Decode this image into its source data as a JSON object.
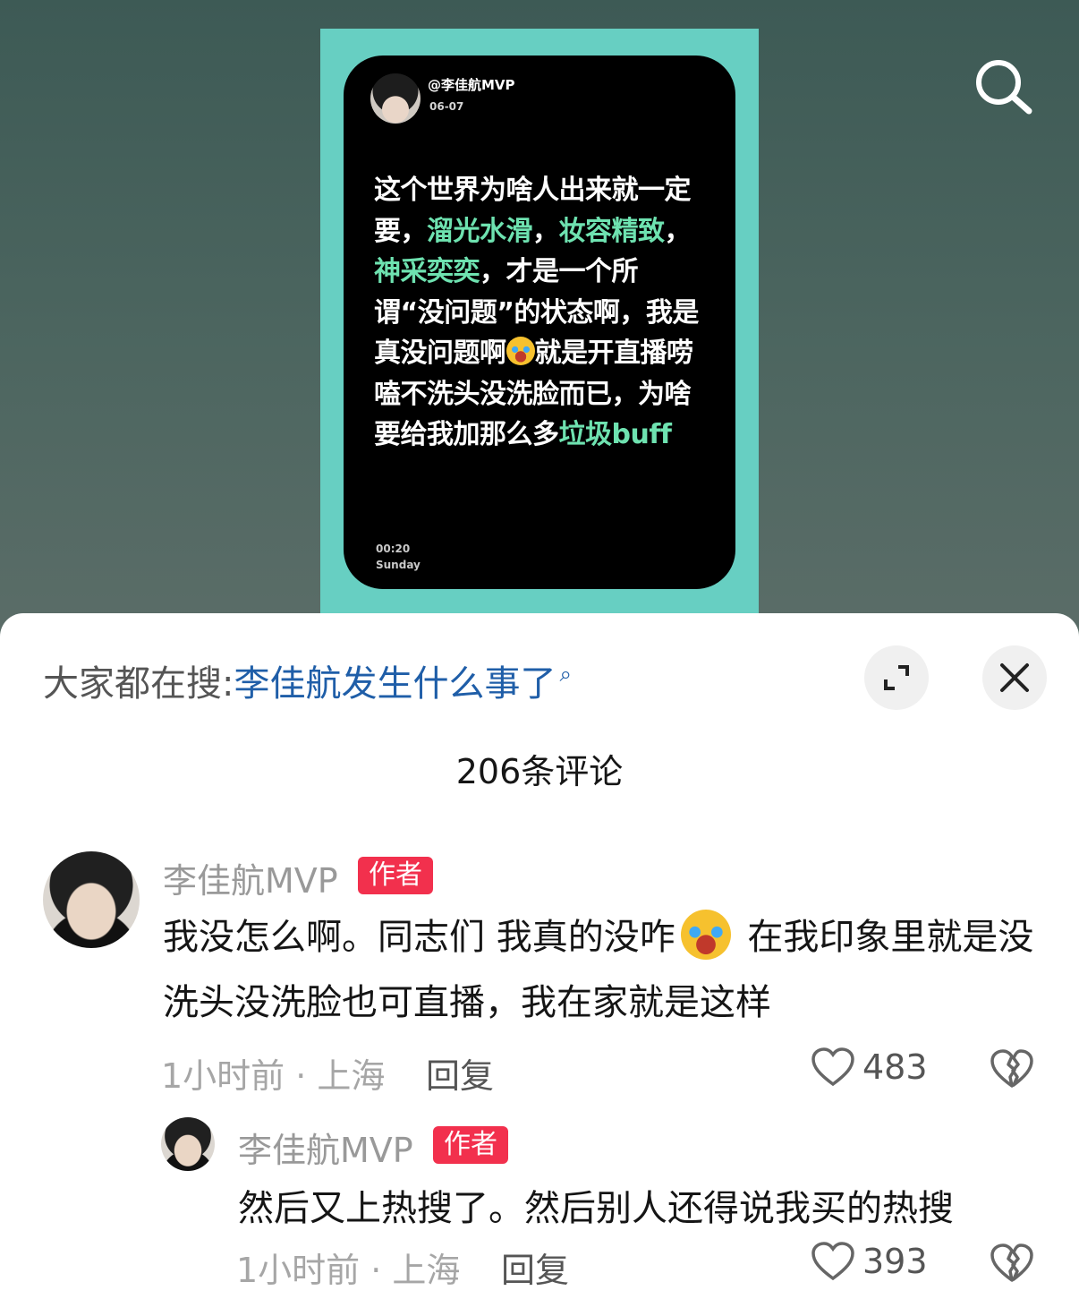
{
  "video": {
    "card": {
      "username": "@李佳航MVP",
      "date": "06-07",
      "text_segments": [
        {
          "t": "这个世界为啥人出来就一定要，",
          "hl": false
        },
        {
          "t": "溜光水滑",
          "hl": true
        },
        {
          "t": "，",
          "hl": false
        },
        {
          "t": "妆容精致",
          "hl": true
        },
        {
          "t": "，",
          "hl": false
        },
        {
          "t": "神采奕奕",
          "hl": true
        },
        {
          "t": "，才是一个所谓“没问题”的状态啊，我是真没问题啊",
          "hl": false
        },
        {
          "t": "就是开直播唠嗑不洗头没洗脸而已，为啥要给我加那么多",
          "hl": false
        },
        {
          "t": "垃圾buff",
          "hl": true
        }
      ],
      "time": "00:20",
      "day": "Sunday"
    },
    "search_icon": "search-icon",
    "colors": {
      "poster_bg": "#67cfc2",
      "highlight": "#6ee2b0"
    }
  },
  "sheet": {
    "trending_prefix": "大家都在搜:",
    "trending_term": "李佳航发生什么事了",
    "comment_count": "206条评论",
    "comments": [
      {
        "nick": "李佳航MVP",
        "badge": "作者",
        "text_before": "我没怎么啊。同志们 我真的没咋",
        "text_after": " 在我印象里就是没洗头没洗脸也可直播，我在家就是这样",
        "meta": "1小时前 · 上海",
        "reply": "回复",
        "likes": "483"
      },
      {
        "nick": "李佳航MVP",
        "badge": "作者",
        "text": "然后又上热搜了。然后别人还得说我买的热搜",
        "meta": "1小时前 · 上海",
        "reply": "回复",
        "likes": "393"
      }
    ],
    "colors": {
      "badge": "#f2304d",
      "trending_term": "#1f5ea8"
    }
  }
}
